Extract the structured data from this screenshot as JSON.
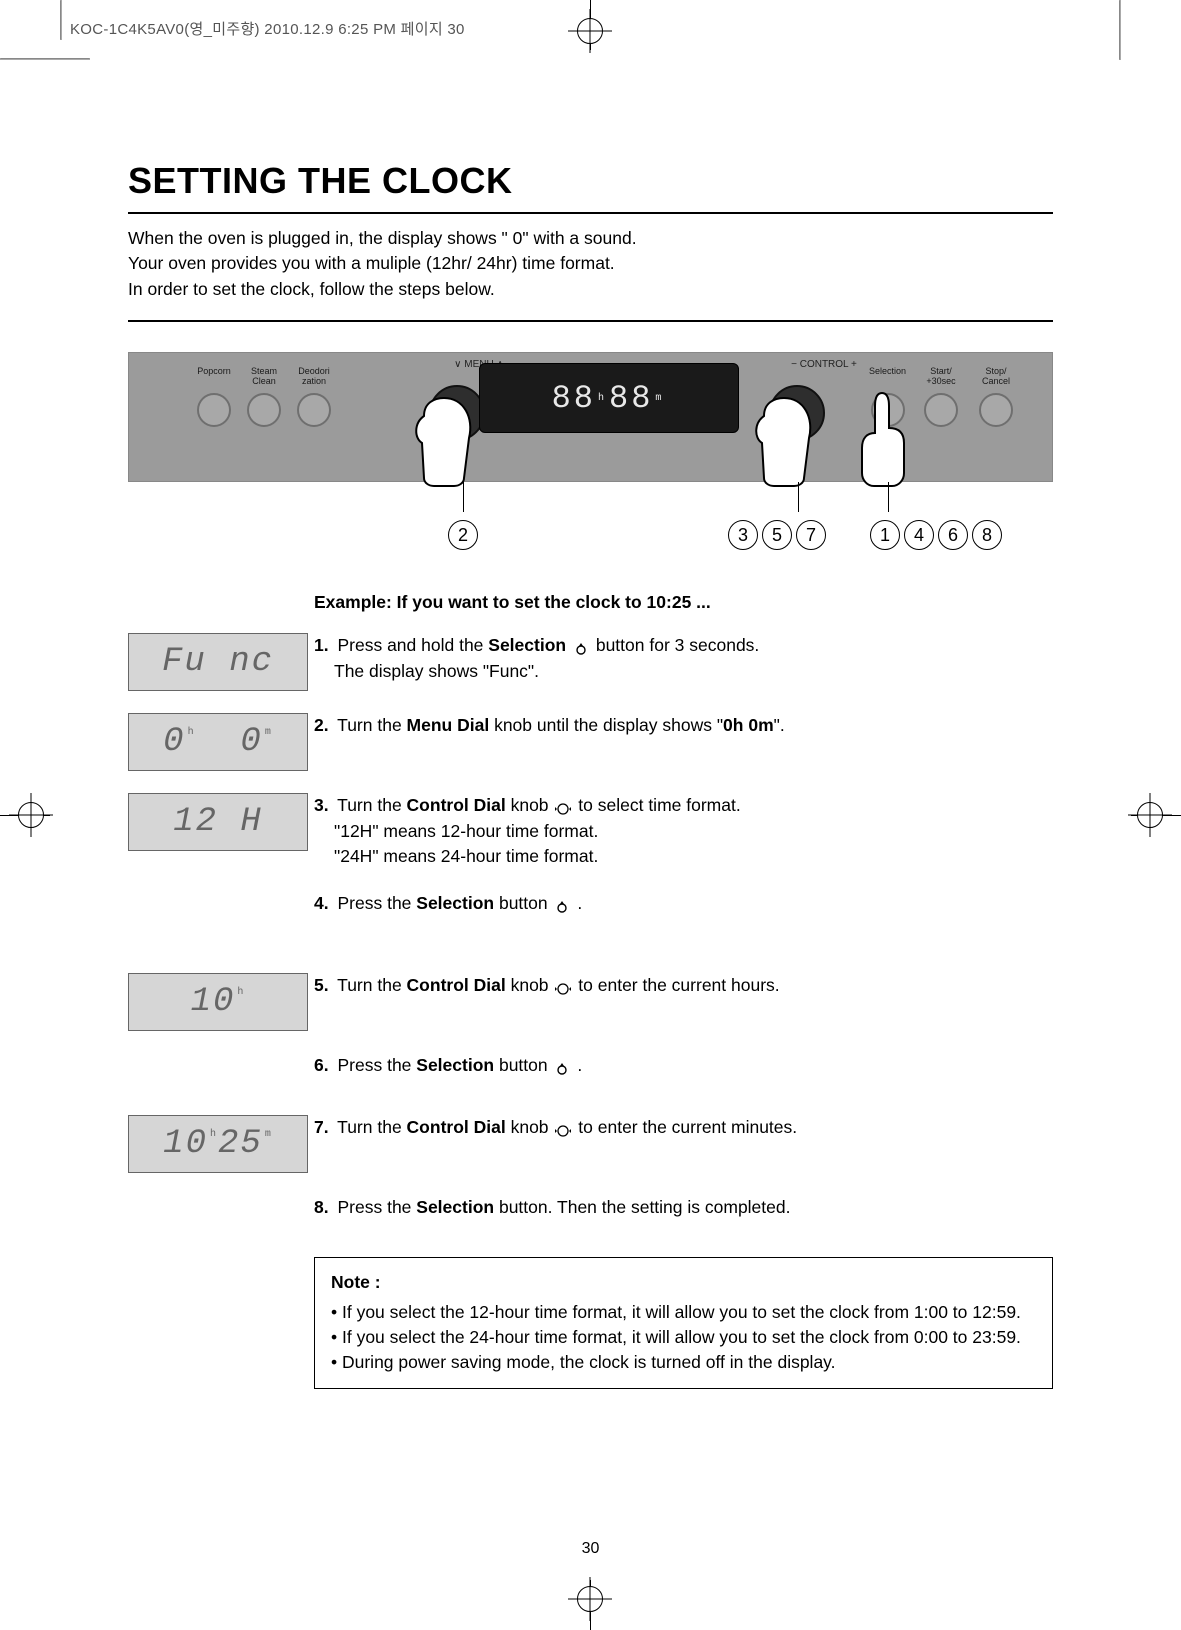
{
  "header_line": "KOC-1C4K5AV0(영_미주향) 2010.12.9 6:25 PM 페이지 30",
  "title": "SETTING THE CLOCK",
  "intro_lines": [
    "When the oven is plugged in, the display shows \" 0\" with a sound.",
    "Your oven provides you with a muliple (12hr/ 24hr) time format.",
    "In order to set the clock, follow the steps below."
  ],
  "panel": {
    "menu_label": "∨  MENU  ∧",
    "control_label": "−  CONTROL  +",
    "buttons_left": [
      {
        "label": "Popcorn"
      },
      {
        "label": "Steam\nClean"
      },
      {
        "label": "Deodori\nzation"
      }
    ],
    "buttons_right": [
      {
        "label": "Selection"
      },
      {
        "label": "Start/\n+30sec"
      },
      {
        "label": "Stop/\nCancel"
      }
    ],
    "display": {
      "hh": "88",
      "sep": "h",
      "mm": "88",
      "m": "m"
    }
  },
  "callouts": {
    "c2": "2",
    "c357": [
      "3",
      "5",
      "7"
    ],
    "c1468": [
      "1",
      "4",
      "6",
      "8"
    ]
  },
  "example_heading": "Example: If you want to set the clock to 10:25 ...",
  "lcd": {
    "func": "Fu nc",
    "zero_h": "0",
    "zero_m": "0",
    "twelveh": "12 H",
    "tenh": "10",
    "ten25_h": "10",
    "ten25_m": "25"
  },
  "steps": {
    "s1a": "Press and hold the ",
    "s1b": "Selection",
    "s1c": " button for 3 seconds.",
    "s1d": "The display shows \"Func\".",
    "s2a": "Turn the ",
    "s2b": "Menu Dial",
    "s2c": " knob until the display shows \"",
    "s2d": "0h 0m",
    "s2e": "\".",
    "s3a": "Turn the ",
    "s3b": "Control Dial",
    "s3c": " knob ",
    "s3d": " to select time format.",
    "s3e": "\"12H\" means 12-hour time format.",
    "s3f": "\"24H\" means 24-hour time format.",
    "s4a": "Press the ",
    "s4b": "Selection",
    "s4c": " button ",
    "s4d": ".",
    "s5a": "Turn the ",
    "s5b": "Control Dial",
    "s5c": " knob ",
    "s5d": " to enter the current hours.",
    "s6a": "Press the ",
    "s6b": "Selection",
    "s6c": " button ",
    "s6d": ".",
    "s7a": "Turn the ",
    "s7b": "Control Dial",
    "s7c": " knob ",
    "s7d": " to enter the current minutes.",
    "s8a": "Press the ",
    "s8b": "Selection",
    "s8c": " button. Then the setting is completed."
  },
  "step_nums": {
    "n1": "1.",
    "n2": "2.",
    "n3": "3.",
    "n4": "4.",
    "n5": "5.",
    "n6": "6.",
    "n7": "7.",
    "n8": "8."
  },
  "note": {
    "title": "Note :",
    "b1": "• If you select the 12-hour time format, it will allow you to set the clock from 1:00 to 12:59.",
    "b2": "• If you select the 24-hour time format, it will allow you to set the clock from 0:00 to 23:59.",
    "b3": "• During power saving mode, the clock is turned off in the display."
  },
  "page_number": "30",
  "units": {
    "h": "h",
    "m": "m"
  }
}
